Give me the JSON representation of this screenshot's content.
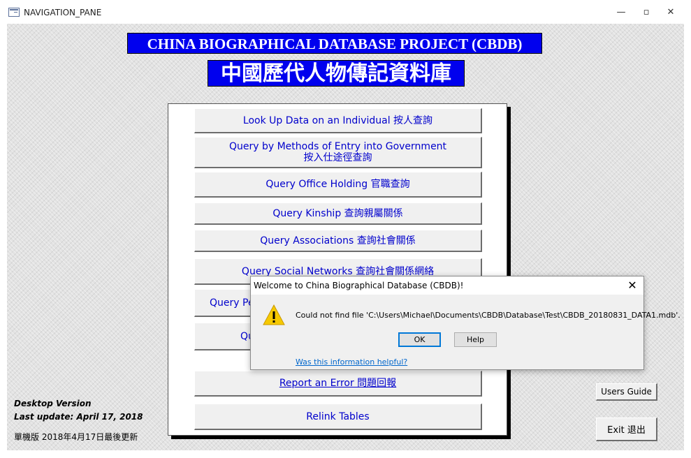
{
  "window": {
    "title": "NAVIGATION_PANE",
    "minimize": "—",
    "restore": "▫",
    "close": "✕"
  },
  "banner": {
    "english": "CHINA BIOGRAPHICAL DATABASE PROJECT (CBDB)",
    "chinese": "中國歷代人物傳記資料庫"
  },
  "menu": {
    "lookup_individual": "Look Up Data on an Individual  按人查詢",
    "entry_line1": "Query by Methods of Entry into Government",
    "entry_line2": "按入仕途徑查詢",
    "office_holding": "Query Office Holding 官職查詢",
    "kinship": "Query Kinship  查詢親屬關係",
    "associations": "Query Associations  查詢社會關係",
    "social_networks": "Query Social Networks 查詢社會關係網絡",
    "partial_1": "Query Pe",
    "partial_2": "Qu",
    "report_error": "Report an Error  問題回報",
    "relink_tables": "Relink Tables"
  },
  "side": {
    "desktop_version": "Desktop Version",
    "last_update": "Last update: April 17, 2018",
    "chinese_version": "單機版  2018年4月17日最後更新",
    "users_guide": "Users Guide",
    "exit": "Exit 退出"
  },
  "dialog": {
    "title": "Welcome to China Biographical Database (CBDB)!",
    "close": "✕",
    "message": "Could not find file 'C:\\Users\\Michael\\Documents\\CBDB\\Database\\Test\\CBDB_20180831_DATA1.mdb'.",
    "ok": "OK",
    "help": "Help",
    "helpful_link": "Was this information helpful?",
    "icon": "warning-icon"
  },
  "colors": {
    "banner_bg": "#0000ee",
    "menu_text": "#0000cc",
    "link": "#0066cc",
    "warning": "#f6c900"
  }
}
